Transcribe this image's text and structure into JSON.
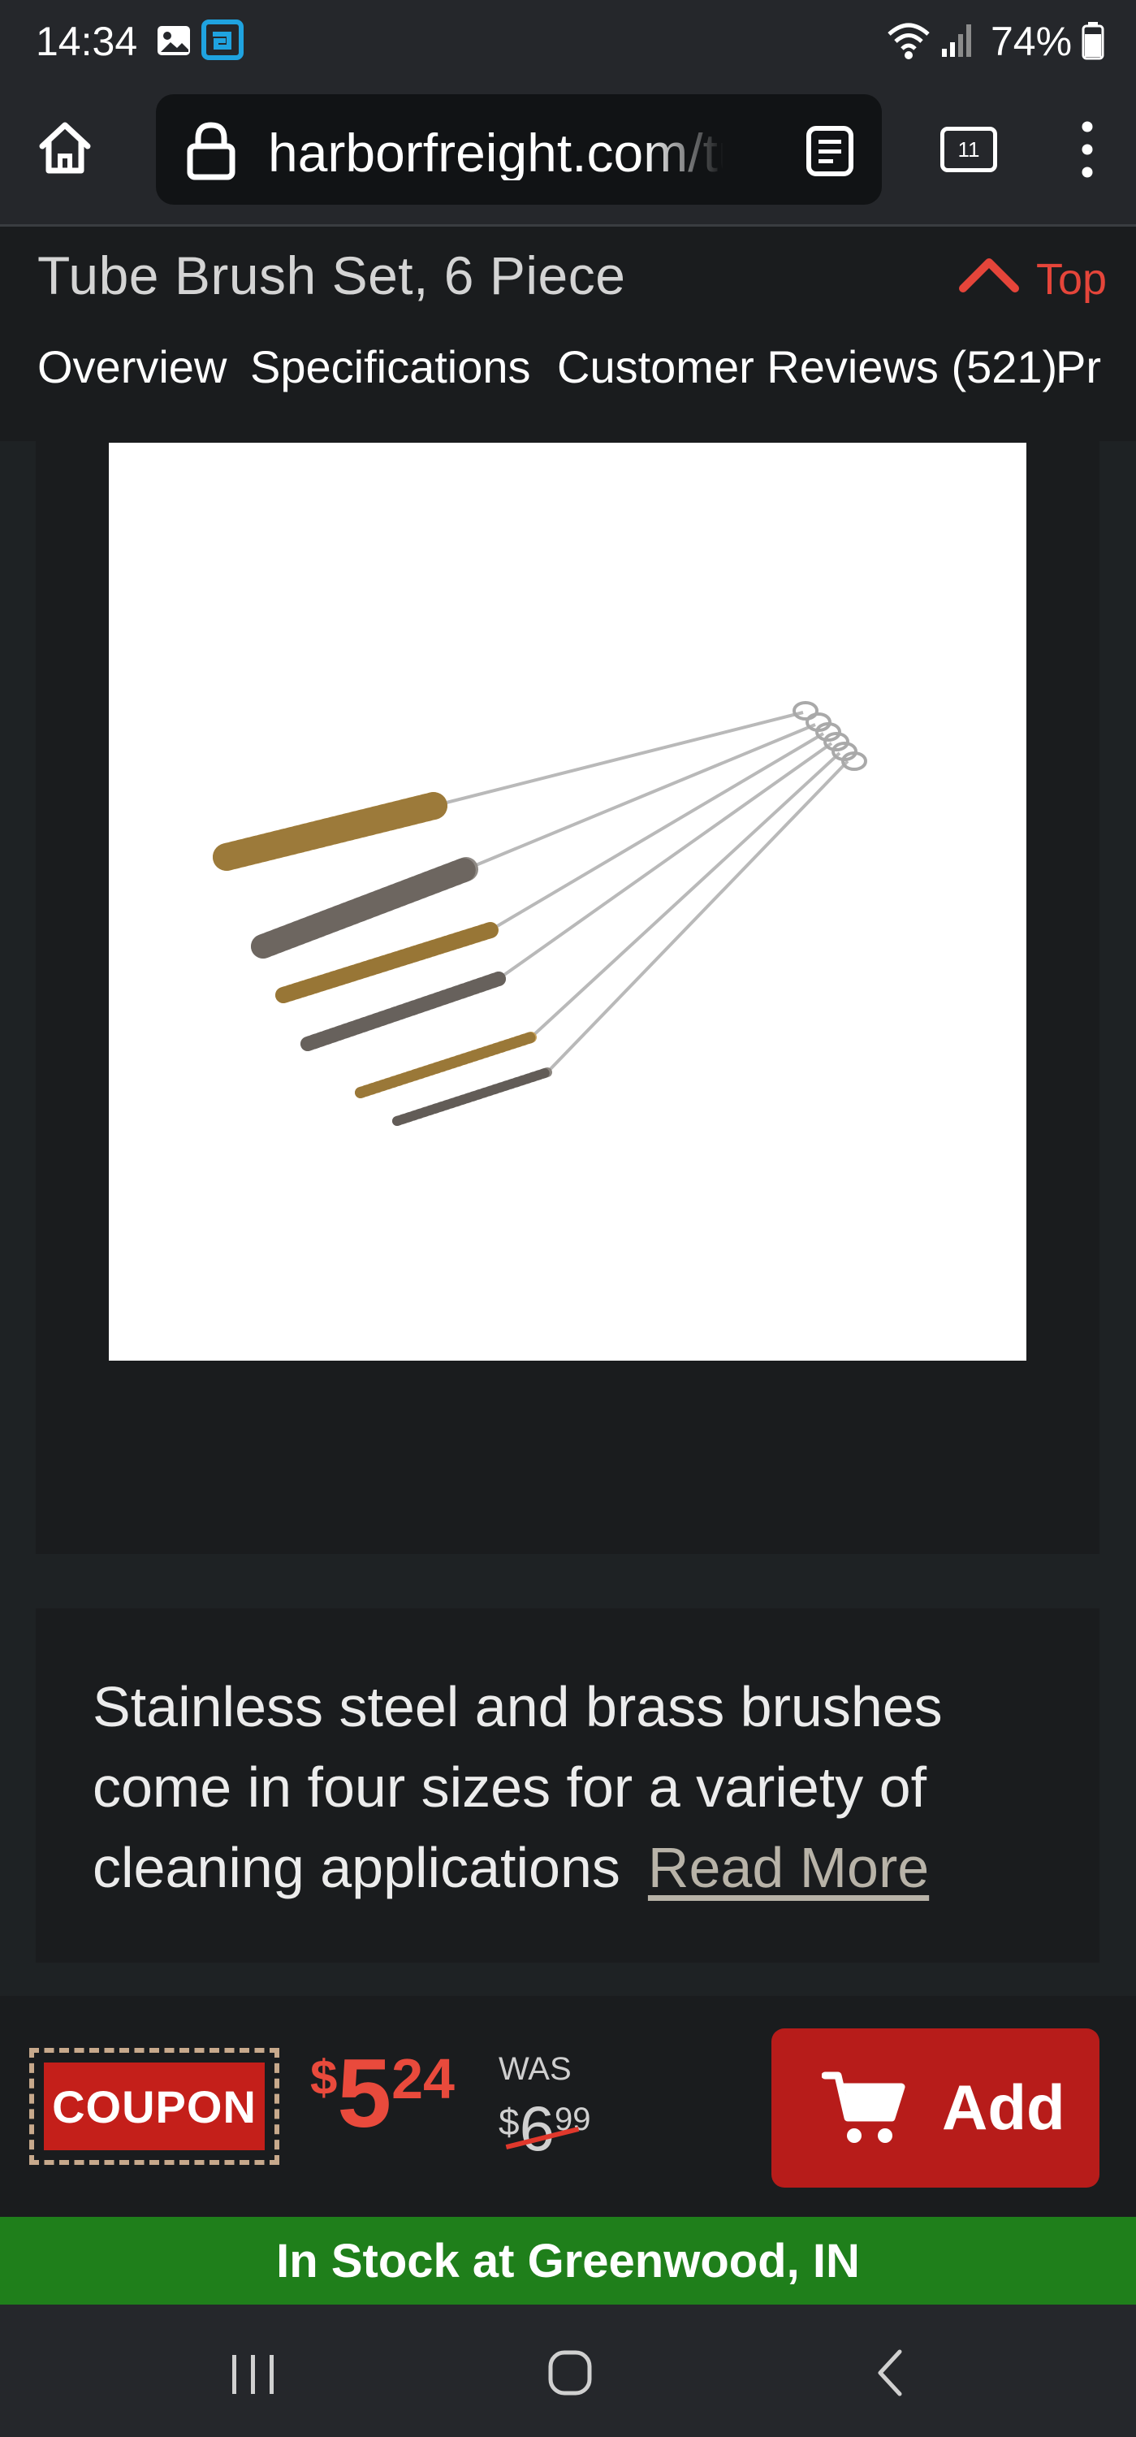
{
  "status_bar": {
    "time": "14:34",
    "battery": "74%",
    "icons": [
      "image-icon",
      "app-badge-icon",
      "wifi-icon",
      "signal-icon",
      "battery-icon"
    ]
  },
  "browser": {
    "url": "harborfreight.com/tube-brush-set",
    "tab_count": "11"
  },
  "product_header": {
    "title": "Tube Brush Set, 6 Piece",
    "top_label": "Top",
    "tabs": [
      "Overview",
      "Specifications",
      "Customer Reviews (521)",
      "Pr"
    ]
  },
  "description": {
    "text": "Stainless steel and brass brushes come in four sizes for a variety of cleaning applications",
    "read_more": "Read More"
  },
  "buy_bar": {
    "coupon_label": "COUPON",
    "price": {
      "currency": "$",
      "dollars": "5",
      "cents": "24"
    },
    "was_label": "WAS",
    "was_price": {
      "currency": "$",
      "dollars": "6",
      "cents": "99"
    },
    "add_label": "Add"
  },
  "stock": {
    "text": "In Stock at Greenwood, IN"
  },
  "colors": {
    "accent_red": "#b71c1a",
    "price_red": "#e94a3c",
    "stock_green": "#1f7f1b",
    "background": "#1e2224"
  }
}
